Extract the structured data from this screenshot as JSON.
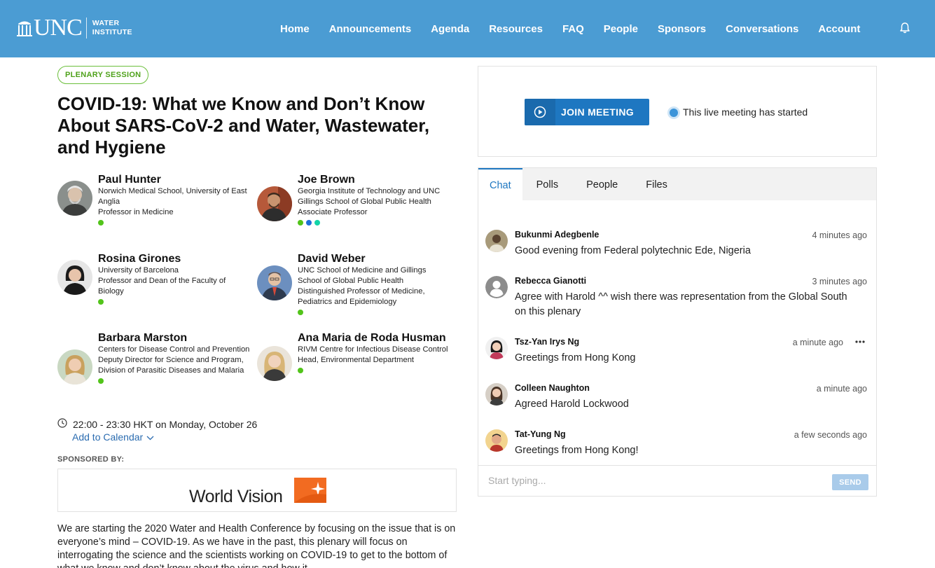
{
  "nav": {
    "logo_main": "UNC",
    "logo_sub_1": "WATER",
    "logo_sub_2": "INSTITUTE",
    "items": [
      {
        "label": "Home"
      },
      {
        "label": "Announcements"
      },
      {
        "label": "Agenda"
      },
      {
        "label": "Resources"
      },
      {
        "label": "FAQ"
      },
      {
        "label": "People"
      },
      {
        "label": "Sponsors"
      },
      {
        "label": "Conversations"
      },
      {
        "label": "Account"
      }
    ],
    "bell_icon": "bell-icon"
  },
  "session": {
    "badge": "PLENARY SESSION",
    "title": "COVID-19: What we Know and Don’t Know About SARS-CoV-2 and Water, Wastewater, and Hygiene",
    "time": "22:00 - 23:30 HKT on Monday, October 26",
    "add_calendar": "Add to Calendar",
    "sponsored_by": "SPONSORED BY:",
    "sponsor_name": "World Vision",
    "description": "We are starting the 2020 Water and Health Conference by focusing on the issue that is on everyone’s mind – COVID-19. As we have in the past, this plenary will focus on interrogating the science and the scientists working on COVID-19 to get to the bottom of what we know and don’t know about the virus and how it"
  },
  "speakers": [
    {
      "name": "Paul Hunter",
      "org": "Norwich Medical School, University of East Anglia",
      "role": "Professor in Medicine"
    },
    {
      "name": "Joe Brown",
      "org": "Georgia Institute of Technology and UNC Gillings School of Global Public Health",
      "role": "Associate Professor"
    },
    {
      "name": "Rosina Girones",
      "org": "University of Barcelona",
      "role": "Professor and Dean of the Faculty of Biology"
    },
    {
      "name": "David Weber",
      "org": "UNC School of Medicine and Gillings School of Global Public Health",
      "role": "Distinguished Professor of Medicine, Pediatrics and Epidemiology"
    },
    {
      "name": "Barbara Marston",
      "org": "Centers for Disease Control and Prevention",
      "role": "Deputy Director for Science and Program, Division of Parasitic Diseases and Malaria"
    },
    {
      "name": "Ana Maria de Roda Husman",
      "org": "RIVM Centre for Infectious Disease Control",
      "role": "Head, Environmental Department"
    }
  ],
  "meeting": {
    "join_label": "JOIN MEETING",
    "status": "This live meeting has started"
  },
  "chat": {
    "tabs": [
      {
        "label": "Chat"
      },
      {
        "label": "Polls"
      },
      {
        "label": "People"
      },
      {
        "label": "Files"
      }
    ],
    "messages": [
      {
        "name": "Bukunmi Adegbenle",
        "time": "4 minutes ago",
        "text": "Good evening from Federal polytechnic Ede, Nigeria"
      },
      {
        "name": "Rebecca Gianotti",
        "time": "3 minutes ago",
        "text": "Agree with Harold ^^ wish there was representation from the Global South on this plenary"
      },
      {
        "name": "Tsz-Yan Irys Ng",
        "time": "a minute ago",
        "text": "Greetings from Hong Kong"
      },
      {
        "name": "Colleen Naughton",
        "time": "a minute ago",
        "text": "Agreed Harold Lockwood"
      },
      {
        "name": "Tat-Yung Ng",
        "time": "a few seconds ago",
        "text": "Greetings from Hong Kong!"
      }
    ],
    "input_placeholder": "Start typing...",
    "send_label": "SEND"
  },
  "colors": {
    "nav_bg": "#4b9cd3",
    "accent": "#1e77c1",
    "badge_green": "#6bbf3b",
    "status_green": "#52c41a",
    "status_blue": "#1e6fd9",
    "status_teal": "#13d4a8",
    "worldvision_orange": "#f26b21"
  }
}
